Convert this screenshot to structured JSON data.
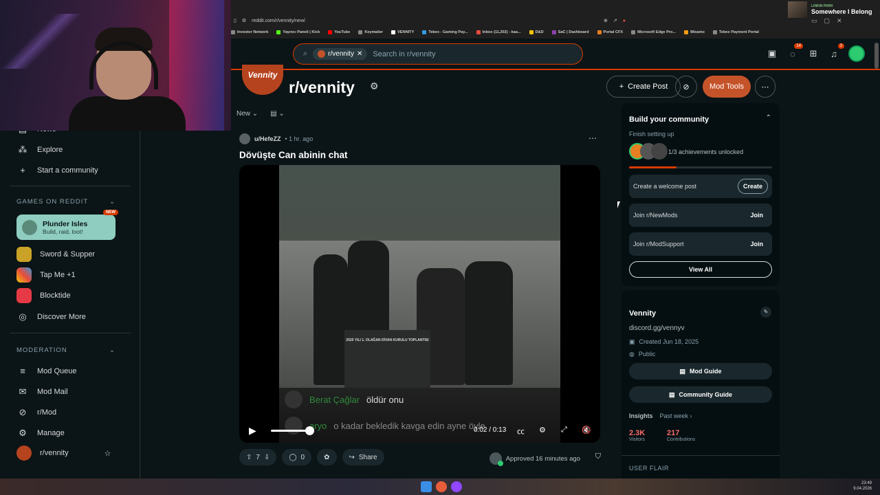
{
  "browser": {
    "url": "reddit.com/r/vennity/new/",
    "bookmarks": [
      "Investor Network",
      "Yayıncı Paneli | Kick",
      "YouTube",
      "Keymailer",
      "VENNITY",
      "Tebex - Gaming Pay...",
      "Inbox (11,202) - kaa...",
      "D&D",
      "SaC | Dashboard",
      "Portal CFX",
      "Microsoft Edge Pro...",
      "Mixamo",
      "Tebex Payment Portal"
    ]
  },
  "now_playing": {
    "artist": "LINKIN PARK",
    "title": "Somewhere I Belong"
  },
  "header": {
    "subreddit_chip": "r/vennity",
    "search_placeholder": "Search in r/vennity",
    "chat_badge": "14",
    "notif_badge": "3"
  },
  "sidebar": {
    "top_items": [
      {
        "label": "News"
      },
      {
        "label": "Explore"
      },
      {
        "label": "Start a community"
      }
    ],
    "games_header": "GAMES ON REDDIT",
    "featured_game": {
      "name": "Plunder Isles",
      "sub": "Build, raid, loot!",
      "badge": "NEW"
    },
    "games": [
      {
        "label": "Sword & Supper"
      },
      {
        "label": "Tap Me +1"
      },
      {
        "label": "Blocktide"
      },
      {
        "label": "Discover More"
      }
    ],
    "moderation_header": "MODERATION",
    "mod_items": [
      {
        "label": "Mod Queue"
      },
      {
        "label": "Mod Mail"
      },
      {
        "label": "r/Mod"
      },
      {
        "label": "Manage"
      },
      {
        "label": "r/vennity"
      }
    ]
  },
  "subreddit": {
    "icon_text": "Vennity",
    "name": "r/vennity",
    "create_post": "Create Post",
    "mod_tools": "Mod Tools",
    "sort": "New"
  },
  "post": {
    "author": "u/HefeZZ",
    "age": "• 1 hr. ago",
    "title": "Dövüşte Can abinin chat",
    "video": {
      "podium_text": "2025 YILI 1. OLAĞAN DİVAN KURULU TOPLANTISI",
      "chat": [
        {
          "user": "Berat Çağlar",
          "msg": "öldür onu"
        },
        {
          "user": "aryo",
          "msg": "o kadar bekledik kavga edin ayne öyle"
        }
      ],
      "time": "0:02 / 0:13",
      "progress": 0.15
    },
    "upvotes": "7",
    "comments": "0",
    "share": "Share",
    "approved": "Approved 16 minutes ago"
  },
  "build_card": {
    "title": "Build your community",
    "subtitle": "Finish setting up",
    "achievements": "1/3 achievements unlocked",
    "achievement_progress": 0.33,
    "rows": [
      {
        "label": "Create a welcome post",
        "action": "Create"
      },
      {
        "label": "Join r/NewMods",
        "action": "Join"
      },
      {
        "label": "Join r/ModSupport",
        "action": "Join"
      }
    ],
    "view_all": "View All"
  },
  "about_card": {
    "name": "Vennity",
    "link": "discord.gg/vennyv",
    "created": "Created Jun 18, 2025",
    "visibility": "Public",
    "mod_guide": "Mod Guide",
    "community_guide": "Community Guide",
    "insights": "Insights",
    "range": "Past week",
    "visitors_value": "2.3K",
    "visitors_label": "Visitors",
    "contrib_value": "217",
    "contrib_label": "Contributions",
    "user_flair": "USER FLAIR"
  },
  "taskbar": {
    "time": "23:49",
    "date": "9.04.2026"
  },
  "colors": {
    "accent": "#d93a00",
    "mod_tools": "#c5532a",
    "plunder": "#8ecdbf",
    "bg": "#0b1416"
  }
}
